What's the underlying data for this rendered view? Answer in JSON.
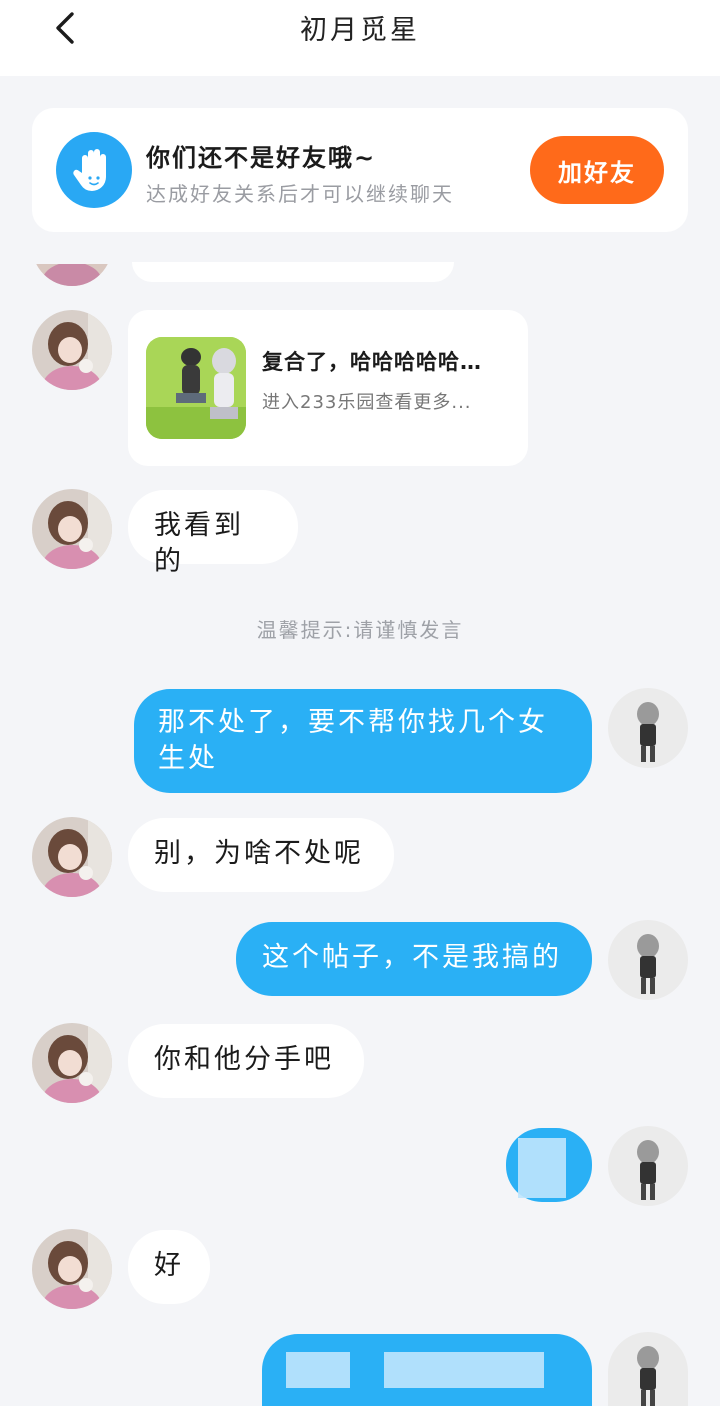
{
  "header": {
    "title": "初月觅星",
    "back_icon": "chevron-left-icon"
  },
  "friend_notice": {
    "icon": "hand-icon",
    "title": "你们还不是好友哦~",
    "subtitle": "达成好友关系后才可以继续聊天",
    "button_label": "加好友",
    "button_color": "#ff6a1a"
  },
  "share_card": {
    "title": "复合了，哈哈哈哈哈…",
    "subtitle": "进入233乐园查看更多..."
  },
  "messages": [
    {
      "side": "in",
      "text": "我看到的"
    },
    {
      "side": "out",
      "text": "那不处了，要不帮你找几个女生处"
    },
    {
      "side": "in",
      "text": "别，为啥不处呢"
    },
    {
      "side": "out",
      "text": "这个帖子，不是我搞的"
    },
    {
      "side": "in",
      "text": "你和他分手吧"
    },
    {
      "side": "out",
      "text": ""
    },
    {
      "side": "in",
      "text": "好"
    },
    {
      "side": "out",
      "text": ""
    }
  ],
  "system_tip": "温馨提示:请谨慎发言",
  "colors": {
    "accent_blue": "#2ab0f5",
    "background": "#f4f5f8"
  }
}
